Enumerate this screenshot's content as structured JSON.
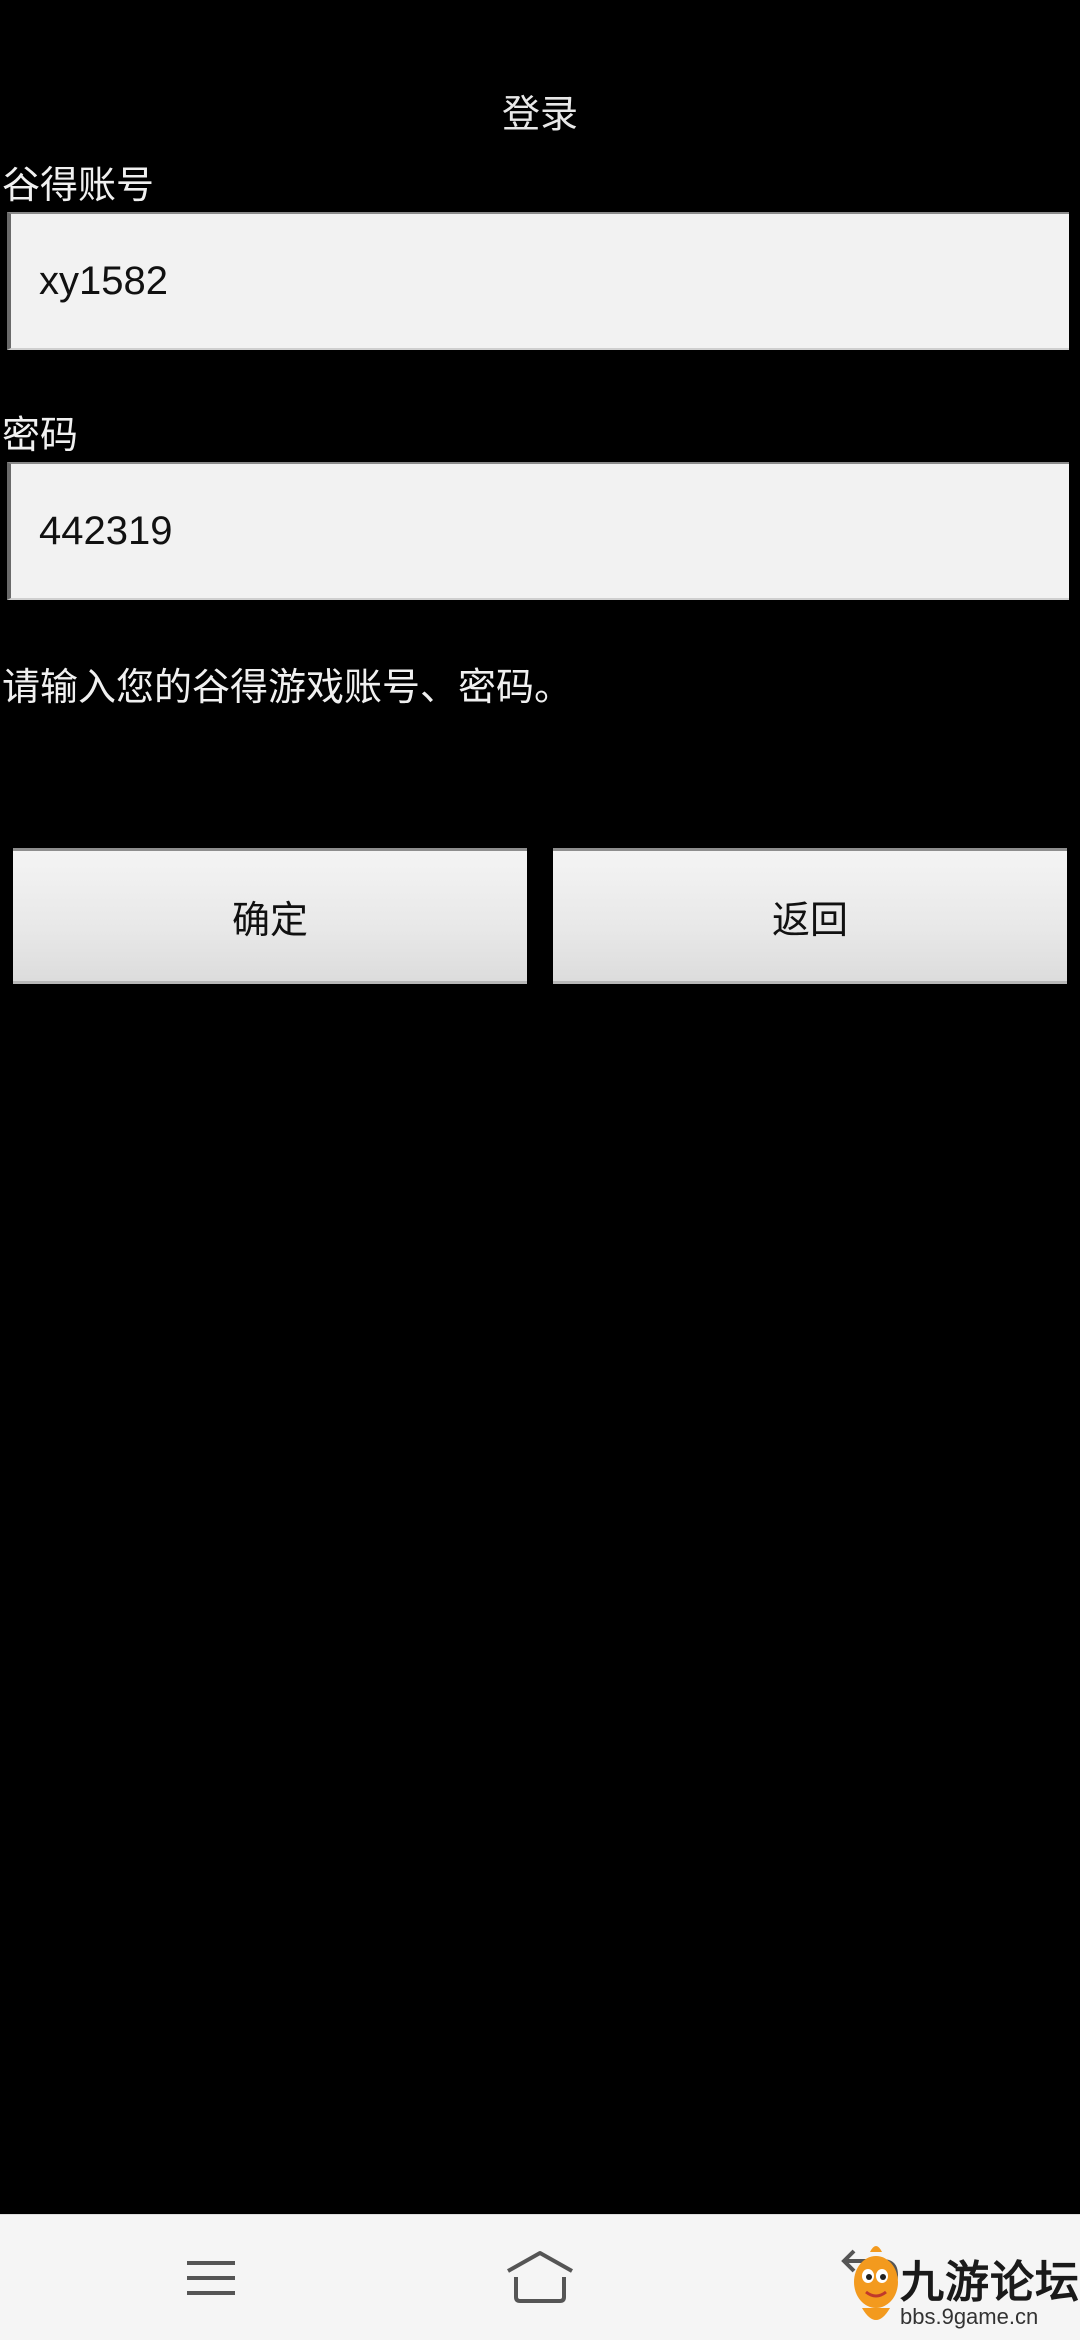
{
  "header": {
    "title": "登录"
  },
  "form": {
    "account_label": "谷得账号",
    "account_value": "xy1582",
    "password_label": "密码",
    "password_value": "442319",
    "hint": "请输入您的谷得游戏账号、密码。"
  },
  "buttons": {
    "confirm_label": "确定",
    "back_label": "返回"
  },
  "navbar": {
    "icons": [
      "menu-icon",
      "home-icon",
      "back-icon"
    ]
  },
  "watermark": {
    "site_name": "九游论坛",
    "url": "bbs.9game.cn"
  },
  "colors": {
    "background": "#000000",
    "field_bg": "#f2f2f2",
    "button_bg": "#e8e8e8",
    "navbar_bg": "#f5f5f5"
  }
}
